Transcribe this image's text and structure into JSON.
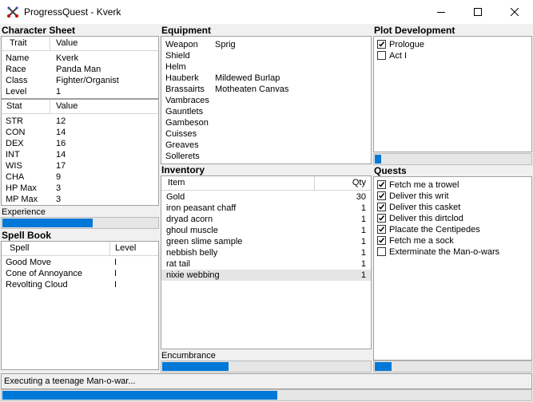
{
  "window": {
    "title": "ProgressQuest - Kverk"
  },
  "character_sheet": {
    "title": "Character Sheet",
    "traits_header": {
      "col1": "Trait",
      "col2": "Value"
    },
    "traits": [
      {
        "name": "Name",
        "value": "Kverk"
      },
      {
        "name": "Race",
        "value": "Panda Man"
      },
      {
        "name": "Class",
        "value": "Fighter/Organist"
      },
      {
        "name": "Level",
        "value": "1"
      }
    ],
    "stats_header": {
      "col1": "Stat",
      "col2": "Value"
    },
    "stats": [
      {
        "name": "STR",
        "value": "12"
      },
      {
        "name": "CON",
        "value": "14"
      },
      {
        "name": "DEX",
        "value": "16"
      },
      {
        "name": "INT",
        "value": "14"
      },
      {
        "name": "WIS",
        "value": "17"
      },
      {
        "name": "CHA",
        "value": "9"
      },
      {
        "name": "HP Max",
        "value": "3"
      },
      {
        "name": "MP Max",
        "value": "3"
      }
    ],
    "experience_label": "Experience",
    "experience_progress": 0.58
  },
  "spell_book": {
    "title": "Spell Book",
    "header": {
      "col1": "Spell",
      "col2": "Level"
    },
    "spells": [
      {
        "name": "Good Move",
        "level": "I"
      },
      {
        "name": "Cone of Annoyance",
        "level": "I"
      },
      {
        "name": "Revolting Cloud",
        "level": "I"
      }
    ]
  },
  "equipment": {
    "title": "Equipment",
    "items": [
      {
        "slot": "Weapon",
        "value": "Sprig"
      },
      {
        "slot": "Shield",
        "value": ""
      },
      {
        "slot": "Helm",
        "value": ""
      },
      {
        "slot": "Hauberk",
        "value": "Mildewed Burlap"
      },
      {
        "slot": "Brassairts",
        "value": "Motheaten Canvas"
      },
      {
        "slot": "Vambraces",
        "value": ""
      },
      {
        "slot": "Gauntlets",
        "value": ""
      },
      {
        "slot": "Gambeson",
        "value": ""
      },
      {
        "slot": "Cuisses",
        "value": ""
      },
      {
        "slot": "Greaves",
        "value": ""
      },
      {
        "slot": "Sollerets",
        "value": ""
      }
    ]
  },
  "inventory": {
    "title": "Inventory",
    "header": {
      "col1": "Item",
      "col2": "Qty"
    },
    "items": [
      {
        "name": "Gold",
        "qty": "30"
      },
      {
        "name": "iron peasant chaff",
        "qty": "1"
      },
      {
        "name": "dryad acorn",
        "qty": "1"
      },
      {
        "name": "ghoul muscle",
        "qty": "1"
      },
      {
        "name": "green slime sample",
        "qty": "1"
      },
      {
        "name": "nebbish belly",
        "qty": "1"
      },
      {
        "name": "rat tail",
        "qty": "1"
      },
      {
        "name": "nixie webbing",
        "qty": "1"
      }
    ],
    "encumbrance_label": "Encumbrance",
    "encumbrance_progress": 0.32
  },
  "plot": {
    "title": "Plot Development",
    "items": [
      {
        "label": "Prologue",
        "checked": true
      },
      {
        "label": "Act I",
        "checked": false
      }
    ],
    "progress": 0.04
  },
  "quests": {
    "title": "Quests",
    "items": [
      {
        "label": "Fetch me a trowel",
        "checked": true
      },
      {
        "label": "Deliver this writ",
        "checked": true
      },
      {
        "label": "Deliver this casket",
        "checked": true
      },
      {
        "label": "Deliver this dirtclod",
        "checked": true
      },
      {
        "label": "Placate the Centipedes",
        "checked": true
      },
      {
        "label": "Fetch me a sock",
        "checked": true
      },
      {
        "label": "Exterminate the Man-o-wars",
        "checked": false
      }
    ],
    "progress": 0.11
  },
  "status": {
    "text": "Executing a teenage Man-o-war...",
    "progress": 0.52
  },
  "colors": {
    "progress_fill": "#0078d7",
    "selected_row": "#e5e5e5"
  },
  "icons": {
    "app": "crossed-swords-icon",
    "minimize": "minimize-icon",
    "maximize": "maximize-icon",
    "close": "close-icon"
  }
}
